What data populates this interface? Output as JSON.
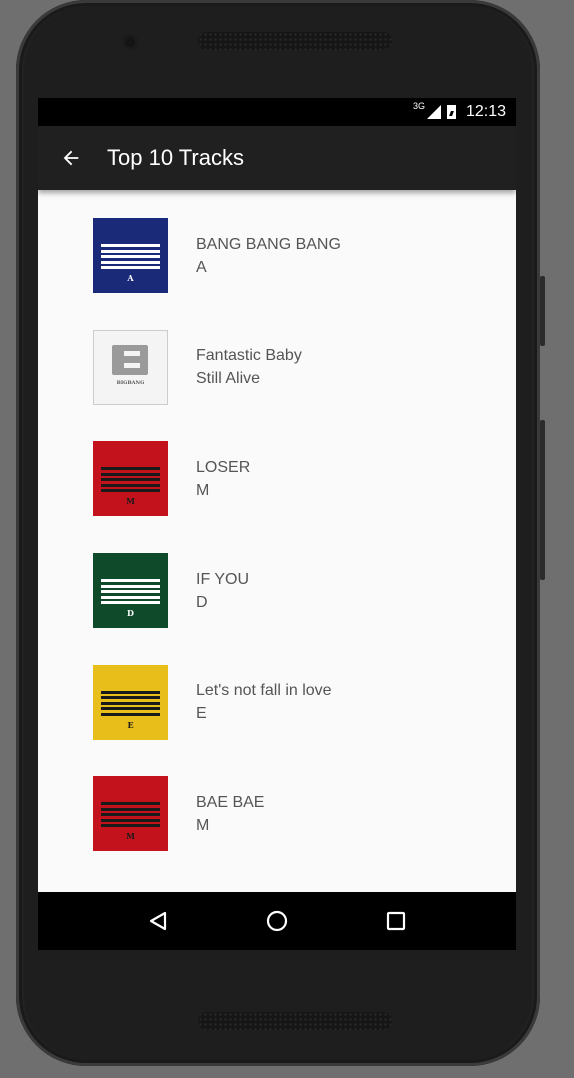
{
  "status_bar": {
    "network": "3G",
    "time": "12:13"
  },
  "app_bar": {
    "title": "Top 10 Tracks"
  },
  "tracks": [
    {
      "title": "BANG BANG BANG",
      "album": "A",
      "cover_color": "#1a2a78",
      "stripe_color": "#ffffff",
      "cover_letter": "A",
      "cover_icon": "album-cover-a"
    },
    {
      "title": "Fantastic Baby",
      "album": "Still Alive",
      "cover_color": "#f4f4f4",
      "stripe_color": "#9a9a9a",
      "cover_letter": "BIGBANG",
      "cover_icon": "album-cover-still-alive"
    },
    {
      "title": "LOSER",
      "album": "M",
      "cover_color": "#c4121c",
      "stripe_color": "#1a1a1a",
      "cover_letter": "M",
      "cover_icon": "album-cover-m"
    },
    {
      "title": "IF YOU",
      "album": "D",
      "cover_color": "#0f4a2a",
      "stripe_color": "#ffffff",
      "cover_letter": "D",
      "cover_icon": "album-cover-d"
    },
    {
      "title": "Let's not fall in love",
      "album": "E",
      "cover_color": "#e8be1a",
      "stripe_color": "#1a1a1a",
      "cover_letter": "E",
      "cover_icon": "album-cover-e"
    },
    {
      "title": "BAE BAE",
      "album": "M",
      "cover_color": "#c4121c",
      "stripe_color": "#1a1a1a",
      "cover_letter": "M",
      "cover_icon": "album-cover-m"
    }
  ],
  "nav_bar": {
    "back_icon": "triangle-back-icon",
    "home_icon": "circle-home-icon",
    "recents_icon": "square-recents-icon"
  }
}
